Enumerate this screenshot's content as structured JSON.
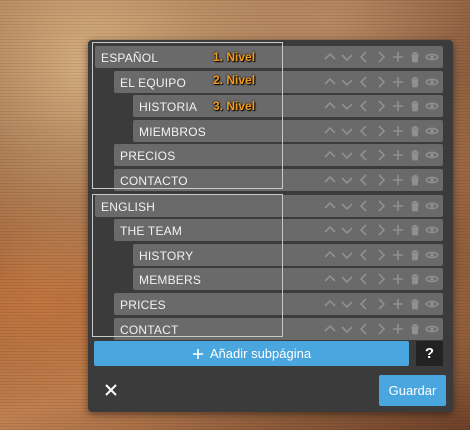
{
  "pages": [
    {
      "label": "ESPAÑOL",
      "level": 1
    },
    {
      "label": "EL EQUIPO",
      "level": 2
    },
    {
      "label": "HISTORIA",
      "level": 3
    },
    {
      "label": "MIEMBROS",
      "level": 3
    },
    {
      "label": "PRECIOS",
      "level": 2
    },
    {
      "label": "CONTACTO",
      "level": 2
    },
    {
      "label": "ENGLISH",
      "level": 1
    },
    {
      "label": "THE TEAM",
      "level": 2
    },
    {
      "label": "HISTORY",
      "level": 3
    },
    {
      "label": "MEMBERS",
      "level": 3
    },
    {
      "label": "PRICES",
      "level": 2
    },
    {
      "label": "CONTACT",
      "level": 2
    }
  ],
  "row_actions": [
    "chevron-up-icon",
    "chevron-down-icon",
    "chevron-left-icon",
    "chevron-right-icon",
    "plus-icon",
    "trash-icon",
    "eye-icon"
  ],
  "annotations": {
    "level1": "1. Nivel",
    "level2": "2. Nivel",
    "level3": "3. Nivel"
  },
  "footer": {
    "add_label": "Añadir subpágina",
    "help_label": "?",
    "close_icon": "close-icon",
    "save_label": "Guardar"
  },
  "colors": {
    "accent": "#4aa6df",
    "annotation": "#f39a1c",
    "row": "#6a6a6a",
    "panel": "#3b3b3b"
  }
}
